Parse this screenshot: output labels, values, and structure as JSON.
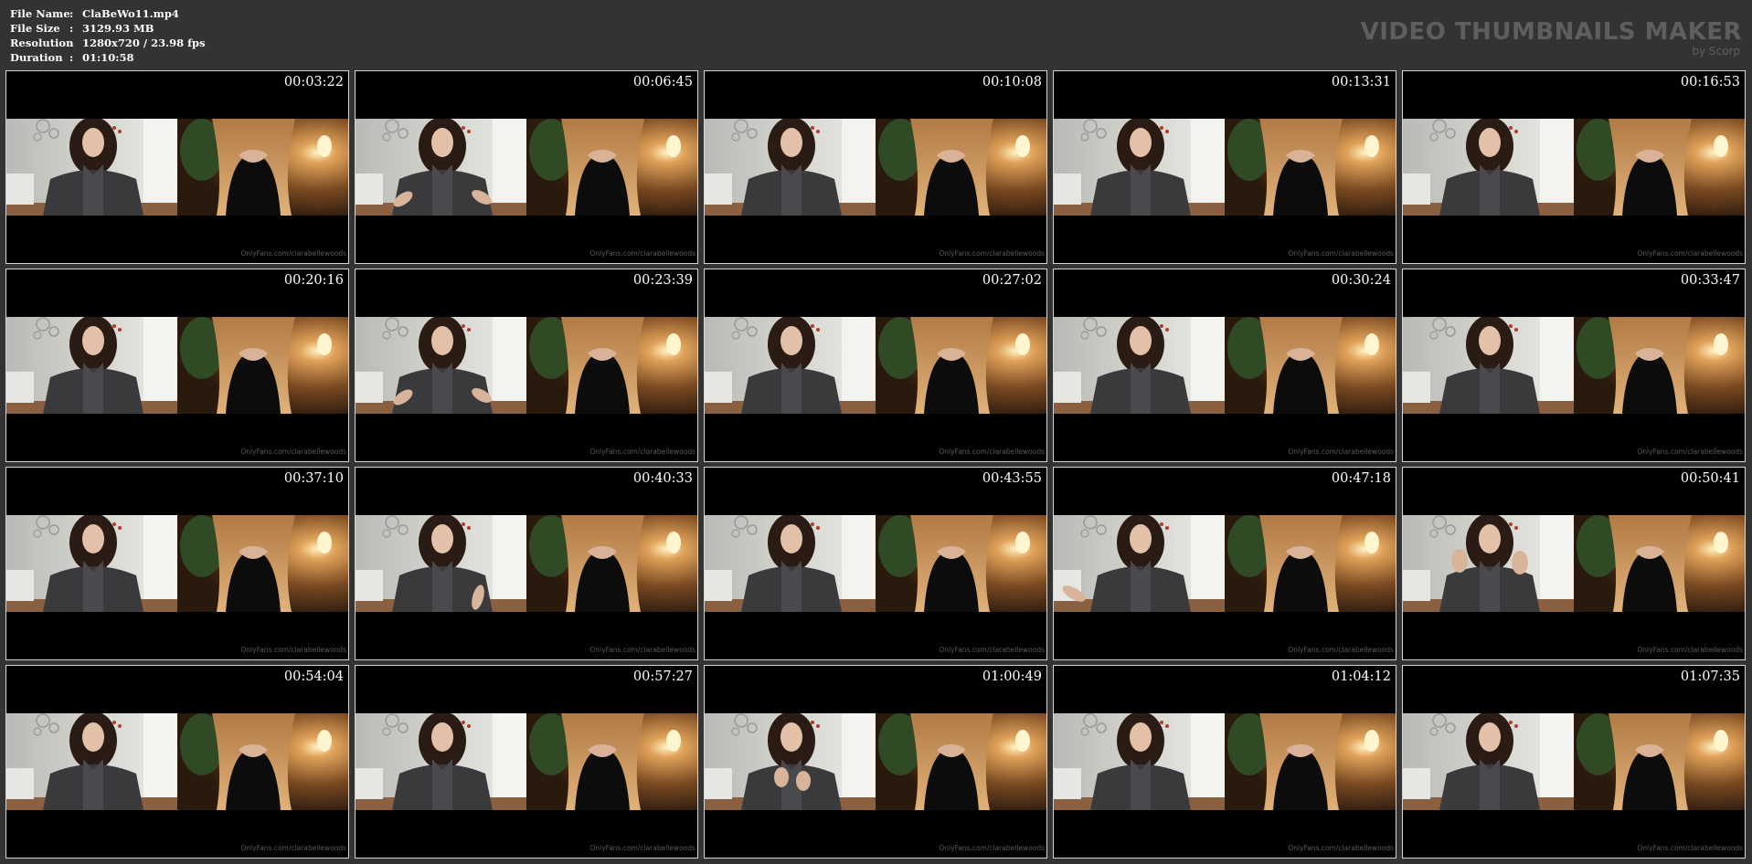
{
  "info": {
    "rows": [
      {
        "label": "File Name",
        "sep": ":",
        "value": "ClaBeWo11.mp4"
      },
      {
        "label": "File Size",
        "sep": ":",
        "value": "3129.93 MB"
      },
      {
        "label": "Resolution",
        "sep": ":",
        "value": "1280x720 / 23.98 fps"
      },
      {
        "label": "Duration",
        "sep": ":",
        "value": "01:10:58"
      }
    ]
  },
  "logo": {
    "title": "VIDEO THUMBNAILS MAKER",
    "subtitle": "by Scorp"
  },
  "watermark": "OnlyFans.com/clarabellewoods",
  "thumbnails": [
    {
      "time": "00:03:22",
      "gesture": "none"
    },
    {
      "time": "00:06:45",
      "gesture": "hands"
    },
    {
      "time": "00:10:08",
      "gesture": "none"
    },
    {
      "time": "00:13:31",
      "gesture": "none"
    },
    {
      "time": "00:16:53",
      "gesture": "none"
    },
    {
      "time": "00:20:16",
      "gesture": "none"
    },
    {
      "time": "00:23:39",
      "gesture": "hands"
    },
    {
      "time": "00:27:02",
      "gesture": "none"
    },
    {
      "time": "00:30:24",
      "gesture": "none"
    },
    {
      "time": "00:33:47",
      "gesture": "none"
    },
    {
      "time": "00:37:10",
      "gesture": "none"
    },
    {
      "time": "00:40:33",
      "gesture": "hand-right"
    },
    {
      "time": "00:43:55",
      "gesture": "none"
    },
    {
      "time": "00:47:18",
      "gesture": "hand-left"
    },
    {
      "time": "00:50:41",
      "gesture": "hands-up"
    },
    {
      "time": "00:54:04",
      "gesture": "none"
    },
    {
      "time": "00:57:27",
      "gesture": "none"
    },
    {
      "time": "01:00:49",
      "gesture": "hands-center"
    },
    {
      "time": "01:04:12",
      "gesture": "none"
    },
    {
      "time": "01:07:35",
      "gesture": "none"
    }
  ],
  "colors": {
    "background": "#333333",
    "thumb_border": "#d6d6d6",
    "logo": "#5e5e5e"
  }
}
